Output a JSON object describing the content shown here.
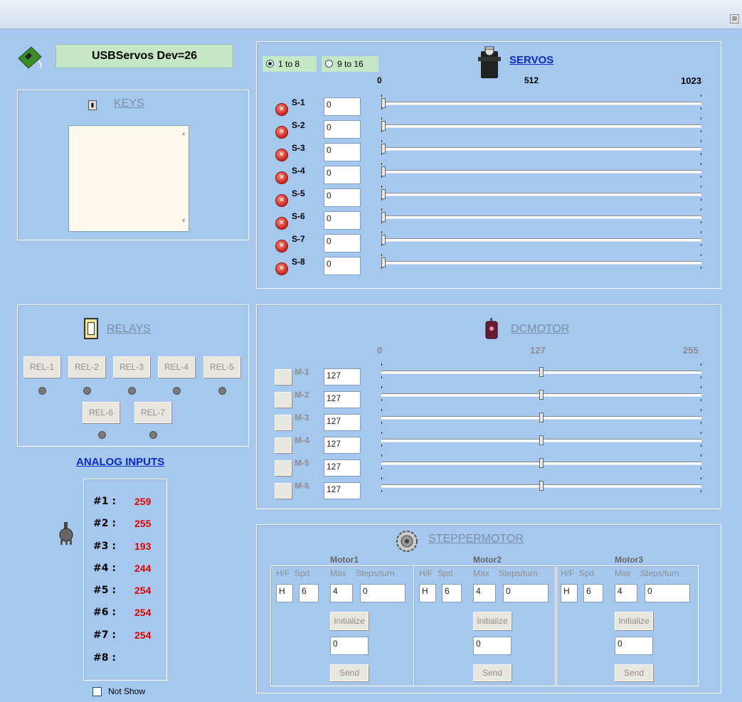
{
  "window": {
    "close_glyph": "⊠"
  },
  "device": {
    "label": "USBServos Dev=26",
    "icon": "usb-board-icon"
  },
  "keys": {
    "title": "KEYS",
    "icon": "keypad-icon",
    "up_arrow": "▲",
    "down_arrow": "▼"
  },
  "relays": {
    "title": "RELAYS",
    "icon": "relay-switch-icon",
    "buttons": [
      "REL-1",
      "REL-2",
      "REL-3",
      "REL-4",
      "REL-5",
      "REL-6",
      "REL-7"
    ]
  },
  "analog": {
    "title": "ANALOG INPUTS",
    "icon": "potentiometer-icon",
    "rows": [
      {
        "label": "#1 :",
        "value": "259"
      },
      {
        "label": "#2 :",
        "value": "255"
      },
      {
        "label": "#3 :",
        "value": "193"
      },
      {
        "label": "#4 :",
        "value": "244"
      },
      {
        "label": "#5 :",
        "value": "254"
      },
      {
        "label": "#6 :",
        "value": "254"
      },
      {
        "label": "#7 :",
        "value": "254"
      },
      {
        "label": "#8 :",
        "value": ""
      }
    ],
    "not_show": "Not Show"
  },
  "servos": {
    "title": "SERVOS",
    "icon": "servo-icon",
    "radio_1": "1 to 8",
    "radio_2": "9 to 16",
    "selected": "1 to 8",
    "scale_min": "0",
    "scale_mid": "512",
    "scale_max": "1023",
    "range_max": 1023,
    "rows": [
      {
        "label": "S-1",
        "value": "0",
        "position": 0
      },
      {
        "label": "S-2",
        "value": "0",
        "position": 0
      },
      {
        "label": "S-3",
        "value": "0",
        "position": 0
      },
      {
        "label": "S-4",
        "value": "0",
        "position": 0
      },
      {
        "label": "S-5",
        "value": "0",
        "position": 0
      },
      {
        "label": "S-6",
        "value": "0",
        "position": 0
      },
      {
        "label": "S-7",
        "value": "0",
        "position": 0
      },
      {
        "label": "S-8",
        "value": "0",
        "position": 0
      }
    ]
  },
  "dcmotor": {
    "title": "DCMOTOR",
    "icon": "dc-motor-icon",
    "scale_min": "0",
    "scale_mid": "127",
    "scale_max": "255",
    "range_max": 255,
    "rows": [
      {
        "label": "M-1",
        "value": "127",
        "position": 127
      },
      {
        "label": "M-2",
        "value": "127",
        "position": 127
      },
      {
        "label": "M-3",
        "value": "127",
        "position": 127
      },
      {
        "label": "M-4",
        "value": "127",
        "position": 127
      },
      {
        "label": "M-5",
        "value": "127",
        "position": 127
      },
      {
        "label": "M-6",
        "value": "127",
        "position": 127
      }
    ]
  },
  "stepper": {
    "title": "STEPPERMOTOR",
    "icon": "stepper-motor-icon",
    "motors": [
      {
        "title": "Motor1",
        "hf_label": "H/F",
        "spd_label": "Spd",
        "max_label": "Max",
        "steps_label": "Steps/turn",
        "hf": "H",
        "spd": "6",
        "max": "4",
        "steps": "0",
        "initialize": "Initialize",
        "send_value": "0",
        "send": "Send"
      },
      {
        "title": "Motor2",
        "hf_label": "H/F",
        "spd_label": "Spd",
        "max_label": "Max",
        "steps_label": "Steps/turn",
        "hf": "H",
        "spd": "6",
        "max": "4",
        "steps": "0",
        "initialize": "Initialize",
        "send_value": "0",
        "send": "Send"
      },
      {
        "title": "Motor3",
        "hf_label": "H/F",
        "spd_label": "Spd",
        "max_label": "Max",
        "steps_label": "Steps/turn",
        "hf": "H",
        "spd": "6",
        "max": "4",
        "steps": "0",
        "initialize": "Initialize",
        "send_value": "0",
        "send": "Send"
      }
    ]
  }
}
